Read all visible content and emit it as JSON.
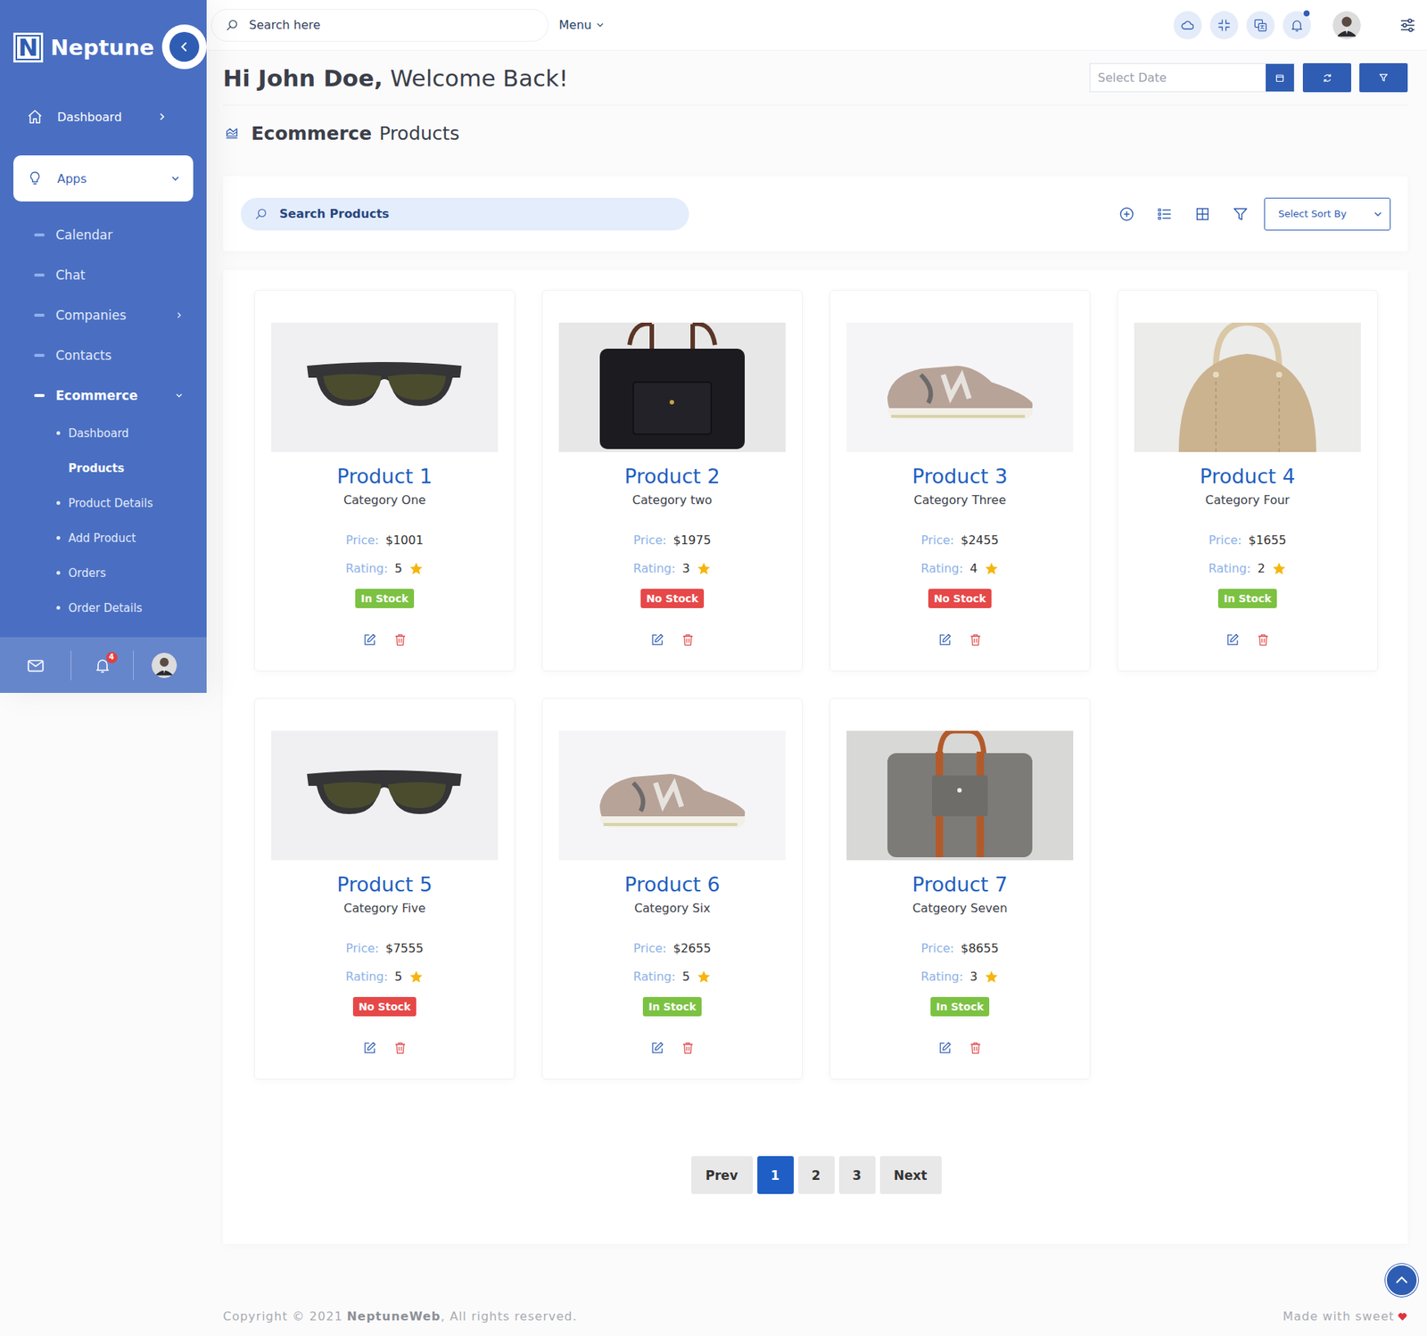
{
  "brand": {
    "letter": "N",
    "name": "Neptune"
  },
  "sidebar": {
    "dashboard": {
      "label": "Dashboard",
      "expanded": false,
      "selected": false
    },
    "apps": {
      "label": "Apps",
      "expanded": true,
      "selected": true
    },
    "app_items": [
      {
        "label": "Calendar",
        "has_children": false,
        "expanded": false,
        "selected": false
      },
      {
        "label": "Chat",
        "has_children": false,
        "expanded": false,
        "selected": false
      },
      {
        "label": "Companies",
        "has_children": true,
        "expanded": false,
        "selected": false
      },
      {
        "label": "Contacts",
        "has_children": false,
        "expanded": false,
        "selected": false
      },
      {
        "label": "Ecommerce",
        "has_children": true,
        "expanded": true,
        "selected": true
      }
    ],
    "ecommerce_items": [
      {
        "label": "Dashboard",
        "selected": false
      },
      {
        "label": "Products",
        "selected": true
      },
      {
        "label": "Product Details",
        "selected": false
      },
      {
        "label": "Add Product",
        "selected": false
      },
      {
        "label": "Orders",
        "selected": false
      },
      {
        "label": "Order Details",
        "selected": false
      }
    ],
    "notification_count": "4"
  },
  "topbar": {
    "search_placeholder": "Search here",
    "menu": "Menu",
    "has_new_notifications": true
  },
  "header": {
    "greeting": "Hi John Doe,",
    "welcome": "Welcome Back!",
    "date_placeholder": "Select Date"
  },
  "page": {
    "title_strong": "Ecommerce",
    "title": "Products"
  },
  "toolbar": {
    "search_placeholder": "Search Products",
    "sort_placeholder": "Select Sort By"
  },
  "products": {
    "price_label": "Price:",
    "rating_label": "Rating:",
    "items": [
      {
        "name": "Product 1",
        "category": "Category One",
        "price": "$1001",
        "rating": "5",
        "stock": "In Stock",
        "color": "#7cc242",
        "kind": "sunglasses"
      },
      {
        "name": "Product 2",
        "category": "Category two",
        "price": "$1975",
        "rating": "3",
        "stock": "No Stock",
        "color": "#e64848",
        "kind": "black-bag"
      },
      {
        "name": "Product 3",
        "category": "Category Three",
        "price": "$2455",
        "rating": "4",
        "stock": "No Stock",
        "color": "#e64848",
        "kind": "sneaker"
      },
      {
        "name": "Product 4",
        "category": "Category Four",
        "price": "$1655",
        "rating": "2",
        "stock": "In Stock",
        "color": "#7cc242",
        "kind": "tan-bag"
      },
      {
        "name": "Product 5",
        "category": "Category Five",
        "price": "$7555",
        "rating": "5",
        "stock": "No Stock",
        "color": "#e64848",
        "kind": "sunglasses"
      },
      {
        "name": "Product 6",
        "category": "Category Six",
        "price": "$2655",
        "rating": "5",
        "stock": "In Stock",
        "color": "#7cc242",
        "kind": "sneaker"
      },
      {
        "name": "Product 7",
        "category": "Catgeory Seven",
        "price": "$8655",
        "rating": "3",
        "stock": "In Stock",
        "color": "#7cc242",
        "kind": "grey-bag"
      }
    ]
  },
  "pagination": {
    "prev": "Prev",
    "next": "Next",
    "pages": [
      {
        "label": "1",
        "selected": true
      },
      {
        "label": "2",
        "selected": false
      },
      {
        "label": "3",
        "selected": false
      }
    ]
  },
  "footer": {
    "copyright": "Copyright © 2021",
    "brand": "NeptuneWeb",
    "rights": ", All rights reserved.",
    "made_with": "Made with sweet"
  }
}
